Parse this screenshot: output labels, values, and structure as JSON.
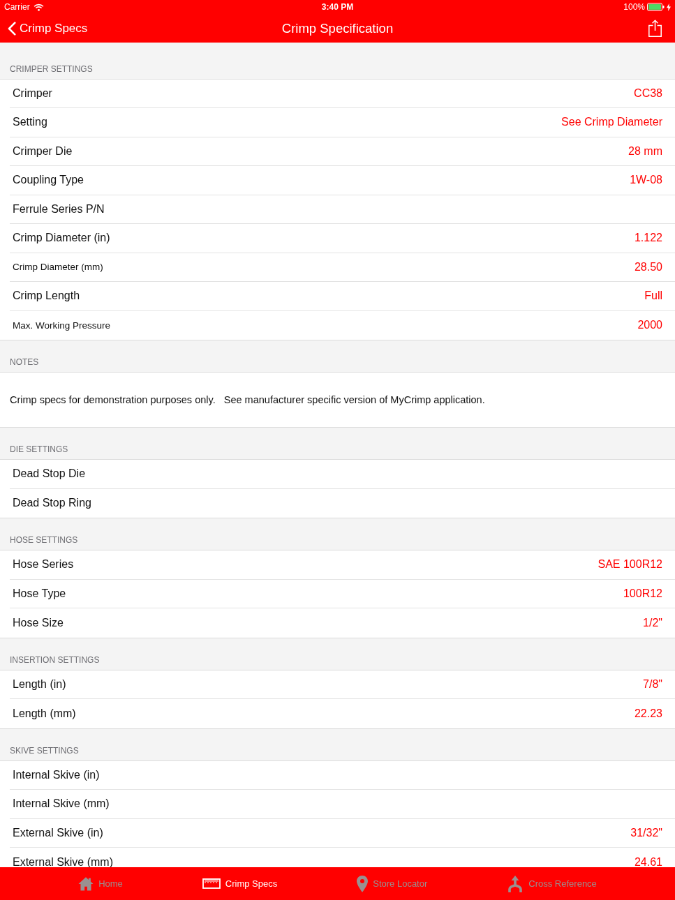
{
  "status_bar": {
    "carrier": "Carrier",
    "time": "3:40 PM",
    "battery": "100%"
  },
  "nav_bar": {
    "back_label": "Crimp Specs",
    "title": "Crimp Specification"
  },
  "sections": [
    {
      "kind": "rows",
      "header": "CRIMPER SETTINGS",
      "rows": [
        {
          "label": "Crimper",
          "value": "CC38",
          "kind": "regular"
        },
        {
          "label": "Setting",
          "value": "See Crimp Diameter",
          "kind": "regular"
        },
        {
          "label": "Crimper Die",
          "value": "28 mm",
          "kind": "regular"
        },
        {
          "label": "Coupling Type",
          "value": "1W-08",
          "kind": "regular"
        },
        {
          "label": "Ferrule Series P/N",
          "kind": "regular"
        },
        {
          "label": "Crimp Diameter (in)",
          "value": "1.122",
          "kind": "regular"
        },
        {
          "label": "Crimp Diameter (mm)",
          "value": "28.50",
          "kind": "small"
        },
        {
          "label": "Crimp Length",
          "value": "Full",
          "kind": "regular"
        },
        {
          "label": "Max. Working Pressure",
          "value": "2000",
          "kind": "small"
        }
      ]
    },
    {
      "kind": "note",
      "header": "NOTES",
      "text": "Crimp specs for demonstration purposes only.   See manufacturer specific version of MyCrimp application."
    },
    {
      "kind": "rows",
      "header": "DIE SETTINGS",
      "rows": [
        {
          "label": "Dead Stop Die",
          "kind": "regular"
        },
        {
          "label": "Dead Stop Ring",
          "kind": "regular"
        }
      ]
    },
    {
      "kind": "rows",
      "header": "HOSE SETTINGS",
      "rows": [
        {
          "label": "Hose Series",
          "value": "SAE 100R12",
          "kind": "regular"
        },
        {
          "label": "Hose Type",
          "value": "100R12",
          "kind": "regular"
        },
        {
          "label": "Hose Size",
          "value": "1/2\"",
          "kind": "regular"
        }
      ]
    },
    {
      "kind": "rows",
      "header": "INSERTION SETTINGS",
      "rows": [
        {
          "label": "Length (in)",
          "value": "7/8\"",
          "kind": "regular"
        },
        {
          "label": "Length (mm)",
          "value": "22.23",
          "kind": "regular"
        }
      ]
    },
    {
      "kind": "rows",
      "header": "SKIVE SETTINGS",
      "rows": [
        {
          "label": "Internal Skive (in)",
          "kind": "regular"
        },
        {
          "label": "Internal Skive (mm)",
          "kind": "regular"
        },
        {
          "label": "External Skive (in)",
          "value": "31/32\"",
          "kind": "regular"
        },
        {
          "label": "External Skive (mm)",
          "value": "24.61",
          "kind": "regular"
        }
      ]
    }
  ],
  "tab_bar": [
    {
      "label": "Home",
      "selected": false
    },
    {
      "label": "Crimp Specs",
      "selected": true
    },
    {
      "label": "Store Locator",
      "selected": false
    },
    {
      "label": "Cross Reference",
      "selected": false
    }
  ]
}
